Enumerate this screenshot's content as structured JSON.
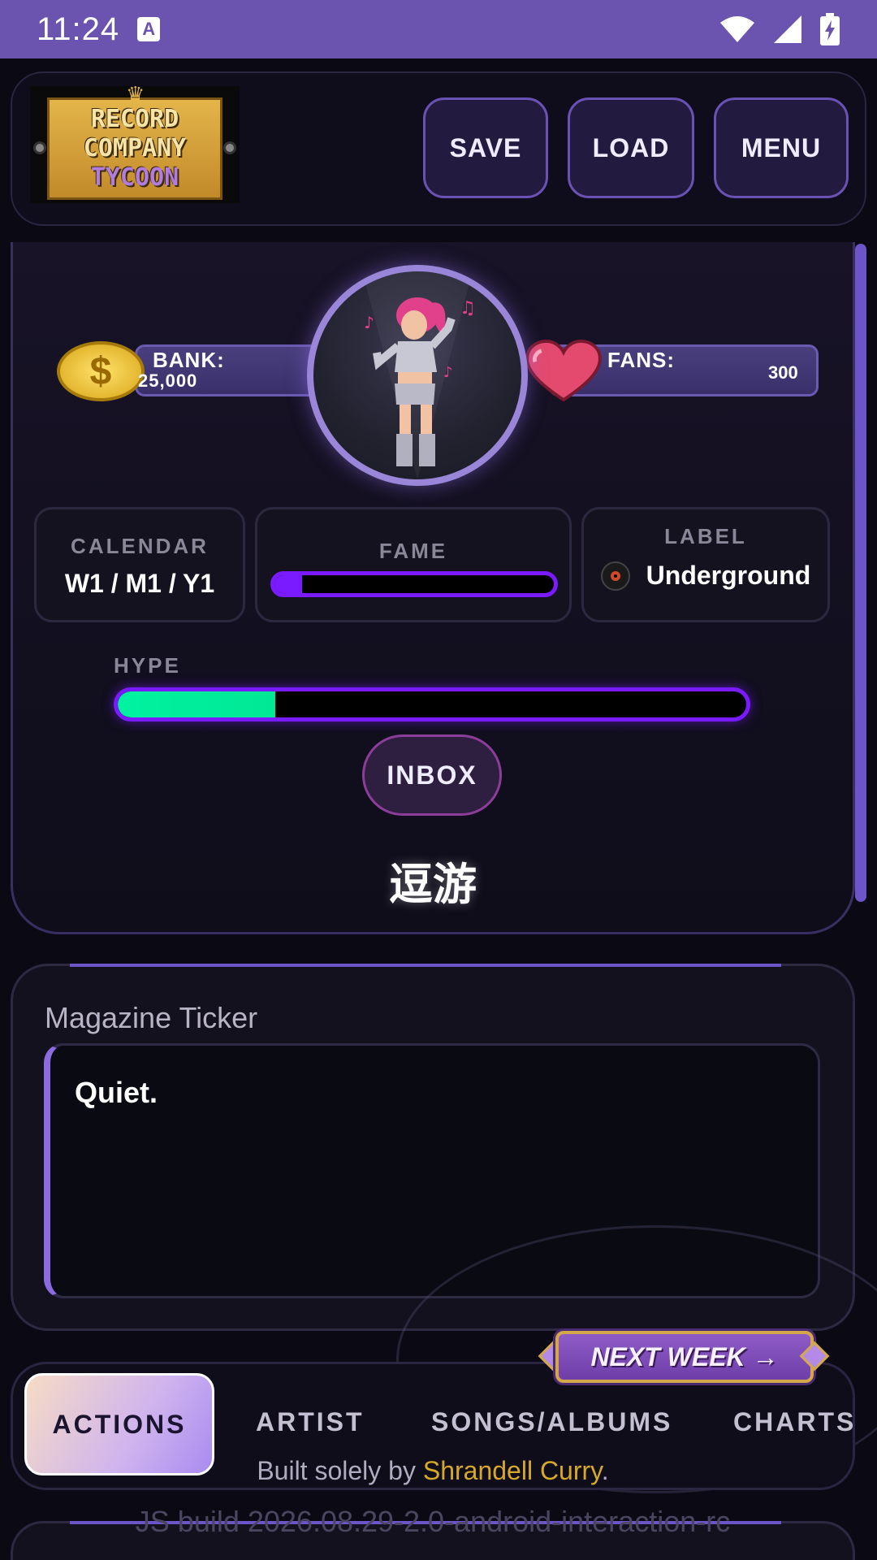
{
  "status_bar": {
    "time": "11:24",
    "notification_icon": "a-icon",
    "icons": [
      "wifi-icon",
      "signal-icon",
      "battery-charging-icon"
    ]
  },
  "header": {
    "logo": {
      "alt": "Record Company Tycoon",
      "lines": [
        "RECORD",
        "COMPANY",
        "TYCOON"
      ]
    },
    "buttons": {
      "save": "SAVE",
      "load": "LOAD",
      "menu": "MENU"
    }
  },
  "stats": {
    "bank_label": "BANK:",
    "bank_value": "25,000",
    "fans_label": "FANS:",
    "fans_value": "300"
  },
  "cards": {
    "calendar_title": "CALENDAR",
    "calendar_value": "W1 / M1 / Y1",
    "fame_title": "FAME",
    "fame_level": 0.1,
    "label_title": "LABEL",
    "label_value": "Underground",
    "label_icon": "vinyl-record-icon"
  },
  "hype": {
    "label": "HYPE",
    "level": 0.25
  },
  "inbox_label": "INBOX",
  "studio_name": "逗游",
  "ticker": {
    "title": "Magazine Ticker",
    "text": "Quiet."
  },
  "next_week_label": "NEXT WEEK →",
  "nav": {
    "tabs": [
      "ACTIONS",
      "ARTIST",
      "SONGS/ALBUMS",
      "CHARTS"
    ],
    "active": "ACTIONS"
  },
  "credit": {
    "prefix": "Built solely by ",
    "author": "Shrandell Curry",
    "suffix": "."
  },
  "build_text": "JS build 2026.08.29-2.0-android-interaction-rc",
  "colors": {
    "status_bar": "#6a54b0",
    "accent_purple": "#7a1bff",
    "hype_green": "#00f2a0",
    "author_gold": "#d6a92a"
  }
}
